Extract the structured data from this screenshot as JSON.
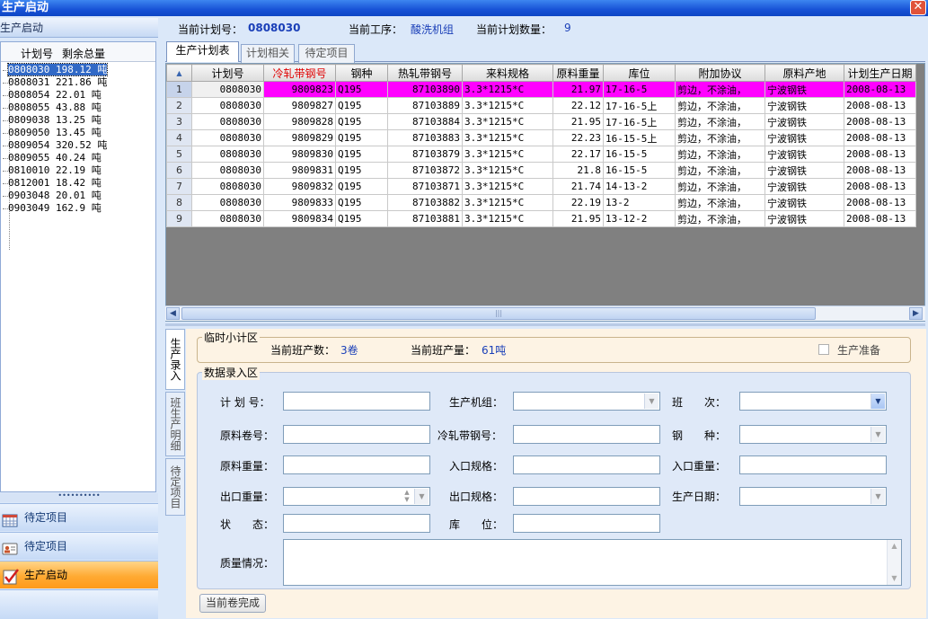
{
  "window": {
    "title": "生产启动",
    "close_glyph": "✕"
  },
  "left": {
    "header": "生产启动",
    "tree_headers": [
      "计划号",
      "剩余总量"
    ],
    "items": [
      {
        "plan": "0808030",
        "qty": "198.12",
        "unit": "吨"
      },
      {
        "plan": "0808031",
        "qty": "221.86",
        "unit": "吨"
      },
      {
        "plan": "0808054",
        "qty": "22.01",
        "unit": "吨"
      },
      {
        "plan": "0808055",
        "qty": "43.88",
        "unit": "吨"
      },
      {
        "plan": "0809038",
        "qty": "13.25",
        "unit": "吨"
      },
      {
        "plan": "0809050",
        "qty": "13.45",
        "unit": "吨"
      },
      {
        "plan": "0809054",
        "qty": "320.52",
        "unit": "吨"
      },
      {
        "plan": "0809055",
        "qty": "40.24",
        "unit": "吨"
      },
      {
        "plan": "0810010",
        "qty": "22.19",
        "unit": "吨"
      },
      {
        "plan": "0812001",
        "qty": "18.42",
        "unit": "吨"
      },
      {
        "plan": "0903048",
        "qty": "20.01",
        "unit": "吨"
      },
      {
        "plan": "0903049",
        "qty": "162.9",
        "unit": "吨"
      }
    ],
    "nav": [
      {
        "label": "待定项目",
        "icon": "calendar-icon"
      },
      {
        "label": "待定项目",
        "icon": "id-card-icon"
      },
      {
        "label": "生产启动",
        "icon": "checklist-icon"
      }
    ]
  },
  "info": {
    "plan_label": "当前计划号：",
    "plan_value": "0808030",
    "process_label": "当前工序：",
    "process_value": "酸洗机组",
    "count_label": "当前计划数量：",
    "count_value": "9"
  },
  "tabs": [
    "生产计划表",
    "计划相关",
    "待定项目"
  ],
  "grid": {
    "columns": [
      "计划号",
      "冷轧带钢号",
      "钢种",
      "热轧带钢号",
      "来料规格",
      "原料重量",
      "库位",
      "附加协议",
      "原料产地",
      "计划生产日期"
    ],
    "rows": [
      [
        "0808030",
        "9809823",
        "Q195",
        "87103890",
        "3.3*1215*C",
        "21.97",
        "17-16-5",
        "剪边，不涂油，",
        "宁波钢铁",
        "2008-08-13"
      ],
      [
        "0808030",
        "9809827",
        "Q195",
        "87103889",
        "3.3*1215*C",
        "22.12",
        "17-16-5上",
        "剪边，不涂油，",
        "宁波钢铁",
        "2008-08-13"
      ],
      [
        "0808030",
        "9809828",
        "Q195",
        "87103884",
        "3.3*1215*C",
        "21.95",
        "17-16-5上",
        "剪边，不涂油，",
        "宁波钢铁",
        "2008-08-13"
      ],
      [
        "0808030",
        "9809829",
        "Q195",
        "87103883",
        "3.3*1215*C",
        "22.23",
        "16-15-5上",
        "剪边，不涂油，",
        "宁波钢铁",
        "2008-08-13"
      ],
      [
        "0808030",
        "9809830",
        "Q195",
        "87103879",
        "3.3*1215*C",
        "22.17",
        "16-15-5",
        "剪边，不涂油，",
        "宁波钢铁",
        "2008-08-13"
      ],
      [
        "0808030",
        "9809831",
        "Q195",
        "87103872",
        "3.3*1215*C",
        "21.8",
        "16-15-5",
        "剪边，不涂油，",
        "宁波钢铁",
        "2008-08-13"
      ],
      [
        "0808030",
        "9809832",
        "Q195",
        "87103871",
        "3.3*1215*C",
        "21.74",
        "14-13-2",
        "剪边，不涂油，",
        "宁波钢铁",
        "2008-08-13"
      ],
      [
        "0808030",
        "9809833",
        "Q195",
        "87103882",
        "3.3*1215*C",
        "22.19",
        "13-2",
        "剪边，不涂油，",
        "宁波钢铁",
        "2008-08-13"
      ],
      [
        "0808030",
        "9809834",
        "Q195",
        "87103881",
        "3.3*1215*C",
        "21.95",
        "13-12-2",
        "剪边，不涂油，",
        "宁波钢铁",
        "2008-08-13"
      ]
    ]
  },
  "vtabs": [
    "生产录入",
    "班生产明细",
    "待定项目"
  ],
  "temp": {
    "title": "临时小计区",
    "count_label": "当前班产数：",
    "count_value": "3卷",
    "weight_label": "当前班产量：",
    "weight_value": "61吨",
    "ready_label": "生产准备"
  },
  "entry": {
    "title": "数据录入区",
    "fields": {
      "plan": "计 划 号：",
      "unit": "生产机组：",
      "shift": "班　　次：",
      "coil": "原料卷号：",
      "cold_no": "冷轧带钢号：",
      "grade": "钢　　种：",
      "weight": "原料重量：",
      "in_spec": "入口规格：",
      "in_weight": "入口重量：",
      "out_weight": "出口重量：",
      "out_spec": "出口规格：",
      "date": "生产日期：",
      "status": "状　　态：",
      "location": "库　　位：",
      "quality": "质量情况："
    },
    "submit": "当前卷完成"
  }
}
